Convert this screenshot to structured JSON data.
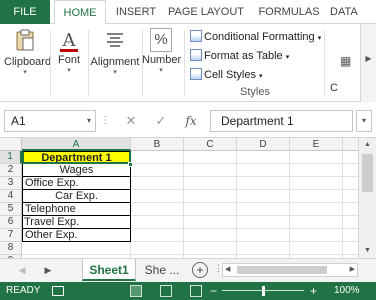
{
  "ribbon_tabs": [
    "FILE",
    "HOME",
    "INSERT",
    "PAGE LAYOUT",
    "FORMULAS",
    "DATA"
  ],
  "ribbon_groups": {
    "clipboard": "Clipboard",
    "font": "Font",
    "alignment": "Alignment",
    "number": "Number",
    "percent_symbol": "%",
    "font_symbol": "A",
    "conditional_formatting": "Conditional Formatting",
    "format_as_table": "Format as Table",
    "cell_styles": "Cell Styles",
    "styles_group": "Styles",
    "cells_partial": "C"
  },
  "formula_bar": {
    "name_box": "A1",
    "fx": "fx",
    "cancel": "✕",
    "enter": "✓",
    "content": "Department 1"
  },
  "columns": [
    "A",
    "B",
    "C",
    "D",
    "E"
  ],
  "rows": [
    "1",
    "2",
    "3",
    "4",
    "5",
    "6",
    "7",
    "8",
    "9"
  ],
  "cells_a": [
    "Department 1",
    "Wages",
    "Office Exp.",
    "Car Exp.",
    "Telephone",
    "Travel Exp.",
    "Other Exp."
  ],
  "sheets": {
    "active": "Sheet1",
    "other": "She ...",
    "add": "+"
  },
  "status": {
    "ready": "READY",
    "zoom_out": "−",
    "zoom_in": "+",
    "zoom": "100%"
  }
}
